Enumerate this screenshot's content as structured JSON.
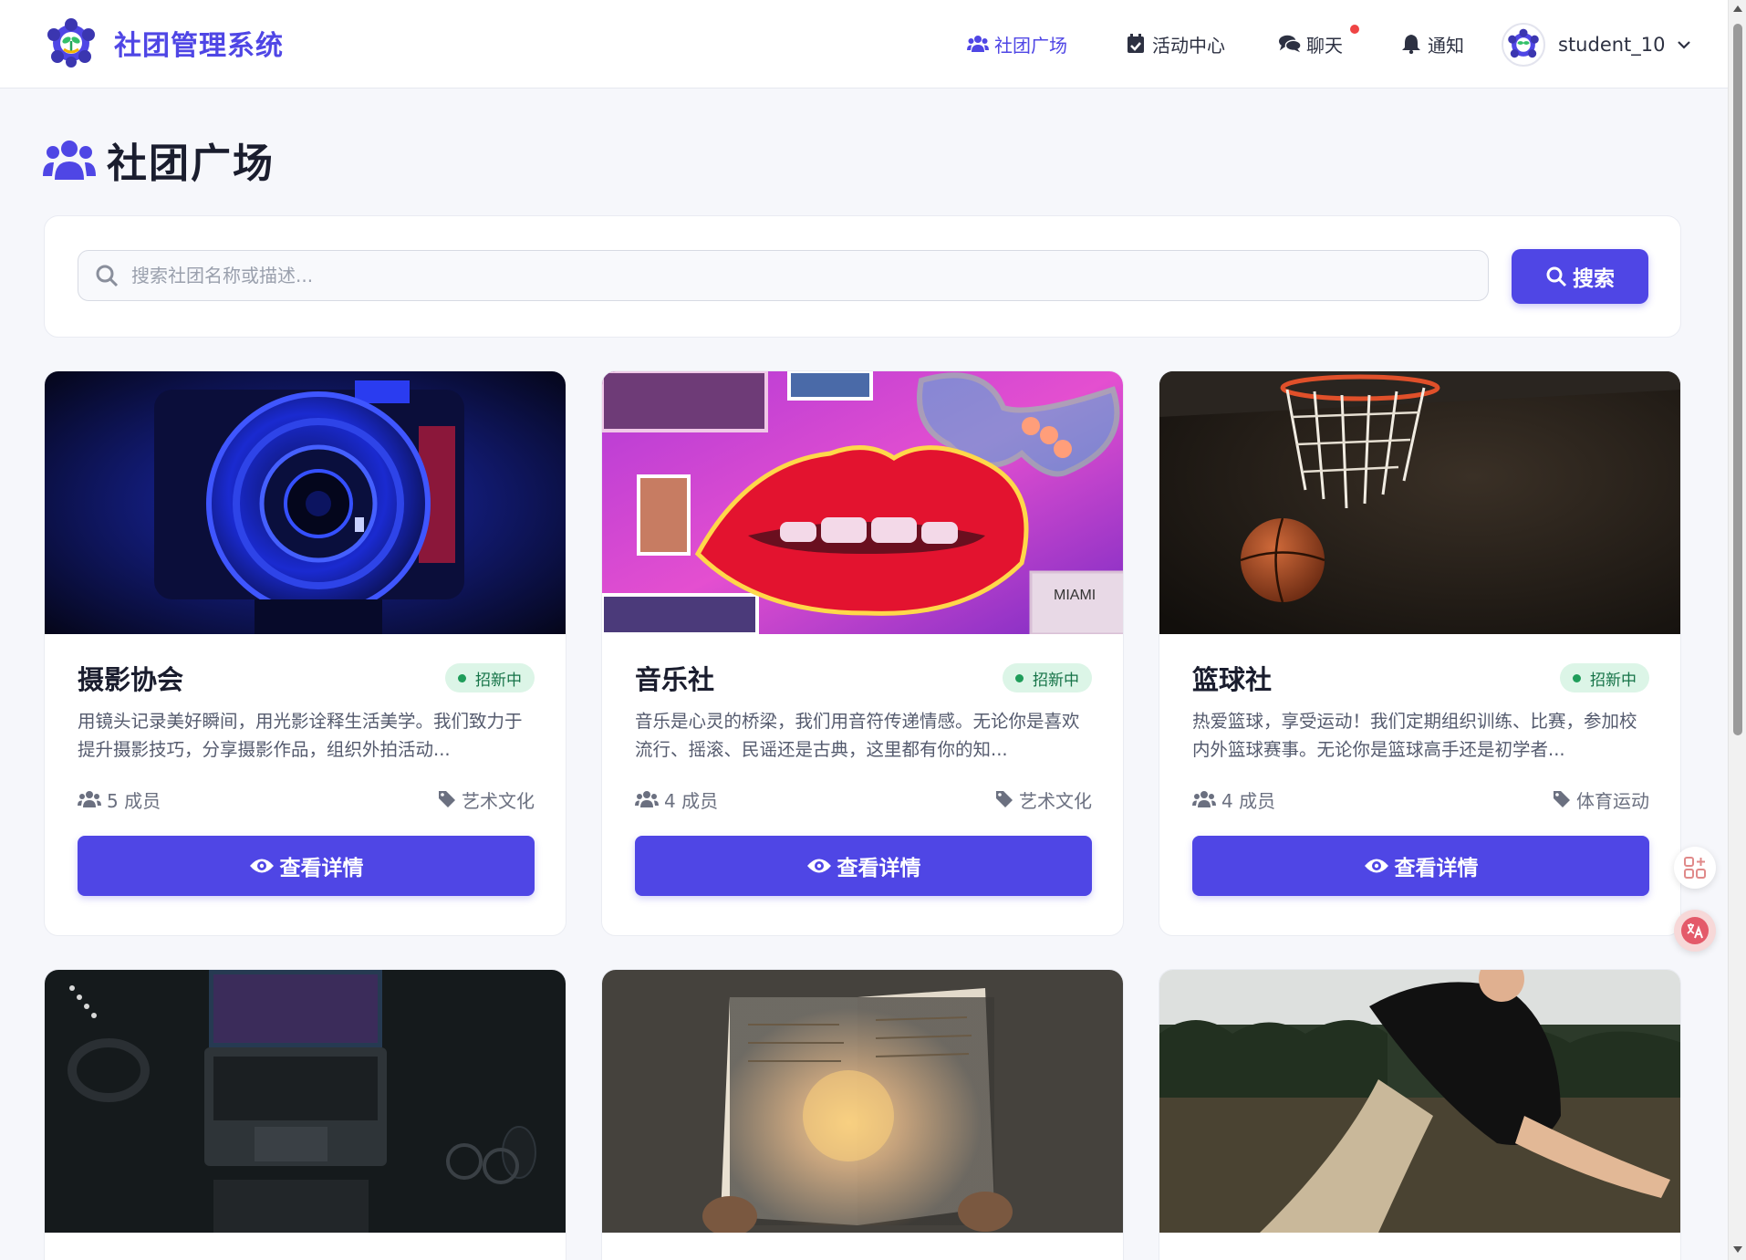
{
  "app": {
    "name": "社团管理系统",
    "logo_icon": "club-logo-icon"
  },
  "nav": {
    "items": [
      {
        "label": "社团广场",
        "icon": "users-icon",
        "active": true
      },
      {
        "label": "活动中心",
        "icon": "calendar-check-icon",
        "active": false
      },
      {
        "label": "聊天",
        "icon": "comments-icon",
        "active": false,
        "has_unread_dot": true
      },
      {
        "label": "通知",
        "icon": "bell-icon",
        "active": false
      }
    ],
    "user": {
      "name": "student_10",
      "avatar_icon": "avatar-icon",
      "menu_icon": "chevron-down-icon"
    }
  },
  "page": {
    "title": "社团广场",
    "title_icon": "users-icon"
  },
  "search": {
    "placeholder": "搜索社团名称或描述...",
    "value": "",
    "button_label": "搜索"
  },
  "clubs": [
    {
      "name": "摄影协会",
      "status": "招新中",
      "description": "用镜头记录美好瞬间，用光影诠释生活美学。我们致力于提升摄影技巧，分享摄影作品，组织外拍活动...",
      "members": "5 成员",
      "category": "艺术文化",
      "button_label": "查看详情",
      "image": "camera-lens-photo"
    },
    {
      "name": "音乐社",
      "status": "招新中",
      "description": "音乐是心灵的桥梁，我们用音符传递情感。无论你是喜欢流行、摇滚、民谣还是古典，这里都有你的知...",
      "members": "4 成员",
      "category": "艺术文化",
      "button_label": "查看详情",
      "image": "neon-lips-photo"
    },
    {
      "name": "篮球社",
      "status": "招新中",
      "description": "热爱篮球，享受运动！我们定期组织训练、比赛，参加校内外篮球赛事。无论你是篮球高手还是初学者...",
      "members": "4 成员",
      "category": "体育运动",
      "button_label": "查看详情",
      "image": "basketball-hoop-photo"
    },
    {
      "image": "laptop-desk-photo"
    },
    {
      "image": "glowing-book-photo"
    },
    {
      "image": "outdoor-sports-photo"
    }
  ],
  "widgets": {
    "apps_icon": "apps-icon",
    "translate_icon": "translate-icon"
  },
  "colors": {
    "primary": "#4f46e5",
    "badge_bg": "#dcf5e7",
    "badge_text": "#157347",
    "page_bg": "#f6f7fb",
    "unread_dot": "#ef4444"
  }
}
